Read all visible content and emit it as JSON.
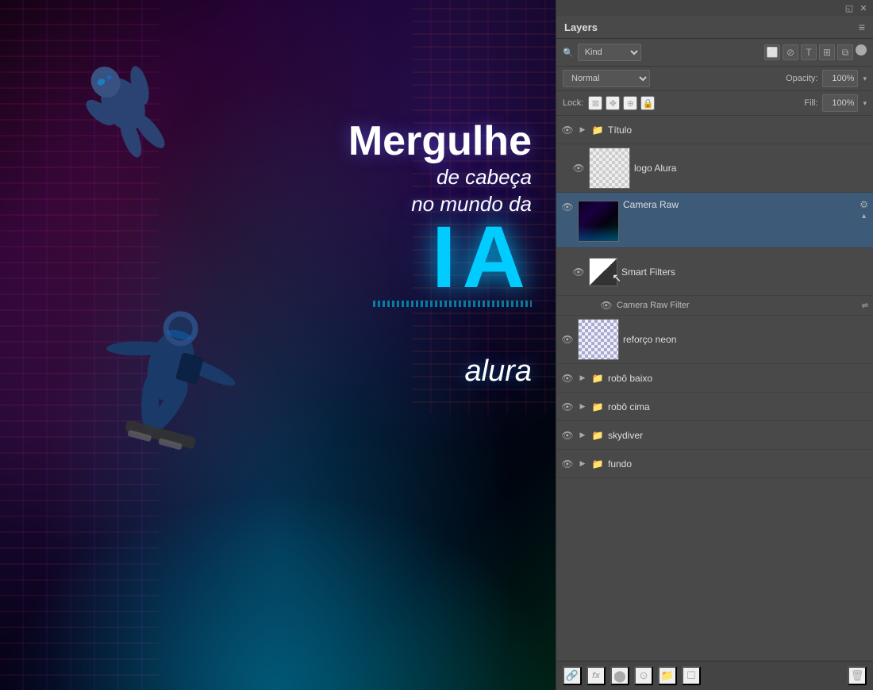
{
  "panel": {
    "title": "Layers",
    "menu_icon": "≡",
    "topbar_icons": [
      "◱",
      "✕"
    ]
  },
  "filter_bar": {
    "search_icon": "🔍",
    "kind_label": "Kind",
    "icons": [
      "⬜",
      "⊘",
      "T",
      "⊞",
      "⧉",
      "●"
    ]
  },
  "blend_mode": {
    "label": "Normal",
    "opacity_label": "Opacity:",
    "opacity_value": "100%"
  },
  "lock_bar": {
    "label": "Lock:",
    "icons": [
      "⊞",
      "✥",
      "⊕",
      "🔒"
    ],
    "fill_label": "Fill:",
    "fill_value": "100%"
  },
  "layers": [
    {
      "id": "titulo",
      "name": "Título",
      "type": "folder",
      "visible": true,
      "expanded": true,
      "indent": 0
    },
    {
      "id": "logo-alura",
      "name": "logo Alura",
      "type": "layer",
      "visible": true,
      "thumb": "checker",
      "indent": 1
    },
    {
      "id": "camera-raw",
      "name": "Camera Raw",
      "type": "smart-object",
      "visible": true,
      "thumb": "scene",
      "indent": 0,
      "active": true,
      "has_settings": true,
      "expanded": true
    },
    {
      "id": "smart-filters",
      "name": "Smart Filters",
      "type": "smart-filters",
      "visible": true,
      "thumb": "white-black",
      "indent": 1
    },
    {
      "id": "camera-raw-filter",
      "name": "Camera Raw Filter",
      "type": "filter",
      "visible": true,
      "indent": 2
    },
    {
      "id": "reforco-neon",
      "name": "reforço neon",
      "type": "layer",
      "visible": true,
      "thumb": "checker-blue",
      "indent": 0
    },
    {
      "id": "robo-baixo",
      "name": "robô baixo",
      "type": "folder",
      "visible": true,
      "expanded": false,
      "indent": 0
    },
    {
      "id": "robo-cima",
      "name": "robô cima",
      "type": "folder",
      "visible": true,
      "expanded": false,
      "indent": 0
    },
    {
      "id": "skydiver",
      "name": "skydiver",
      "type": "folder",
      "visible": true,
      "expanded": false,
      "indent": 0
    },
    {
      "id": "fundo",
      "name": "fundo",
      "type": "folder",
      "visible": true,
      "expanded": false,
      "indent": 0
    }
  ],
  "bottom_toolbar": {
    "link_icon": "🔗",
    "fx_label": "fx",
    "adjustment_icon": "⬤",
    "mask_icon": "⊙",
    "folder_icon": "📁",
    "new_layer_icon": "☐",
    "delete_icon": "🗑"
  }
}
